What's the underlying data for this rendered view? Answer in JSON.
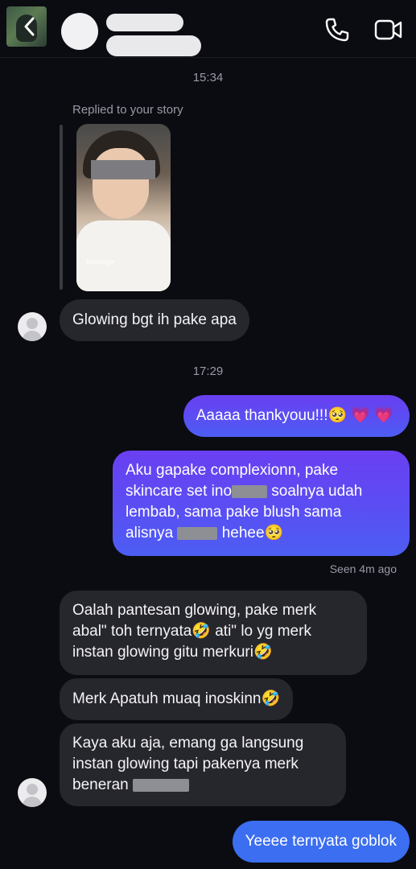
{
  "header": {
    "icons": {
      "back": "chevron-left-icon",
      "call": "phone-icon",
      "video": "video-camera-icon"
    }
  },
  "colors": {
    "background": "#0b0b12",
    "incoming_bubble": "#26262d",
    "outgoing_bubble": "#5b47f0",
    "outgoing_bubble_last": "#3b6ef0",
    "meta_text": "#9a9aa6"
  },
  "thread": {
    "timestamps": [
      "15:34",
      "17:29"
    ],
    "story_reply": {
      "label": "Replied to your story",
      "thumbnail_caption": "Morning"
    },
    "messages": [
      {
        "lines": [
          "Glowing bgt ih pake apa"
        ]
      },
      {
        "lines": [
          "Aaaaa thankyouu!!!🥺 💗 💗"
        ]
      },
      {
        "lines": [
          "Aku gapake complexionn, pake",
          "skincare set ino",
          "lembab, sama pake blush sama",
          "alisnya",
          " hehee🥺"
        ],
        "fragments": {
          "l2b": " soalnya udah"
        }
      },
      {
        "lines": [
          "Oalah pantesan glowing, pake merk",
          "abal\" toh ternyata🤣 ati\" lo yg merk",
          "instan glowing gitu merkuri🤣"
        ]
      },
      {
        "lines": [
          "Merk Apatuh muaq inoskinn🤣"
        ]
      },
      {
        "lines": [
          "Kaya aku aja, emang ga langsung",
          "instan glowing tapi pakenya merk",
          "beneran"
        ]
      },
      {
        "lines": [
          "Yeeee ternyata goblok"
        ]
      }
    ],
    "seen": "Seen 4m ago"
  }
}
